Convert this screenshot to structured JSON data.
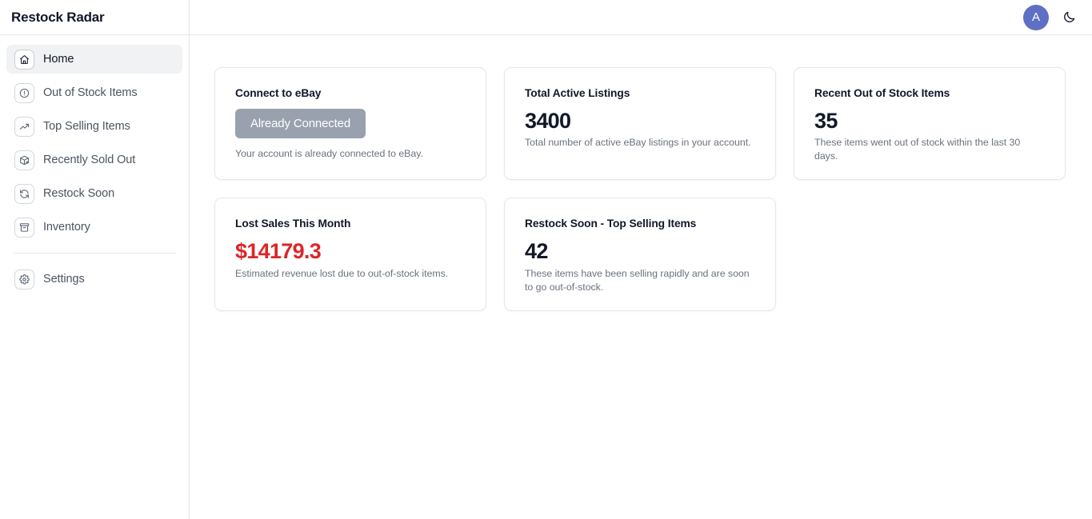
{
  "brand": {
    "title": "Restock Radar"
  },
  "sidebar": {
    "items": [
      {
        "label": "Home",
        "icon": "home-icon",
        "active": true
      },
      {
        "label": "Out of Stock Items",
        "icon": "alert-circle-icon",
        "active": false
      },
      {
        "label": "Top Selling Items",
        "icon": "trending-up-icon",
        "active": false
      },
      {
        "label": "Recently Sold Out",
        "icon": "package-x-icon",
        "active": false
      },
      {
        "label": "Restock Soon",
        "icon": "refresh-cw-icon",
        "active": false
      },
      {
        "label": "Inventory",
        "icon": "archive-icon",
        "active": false
      }
    ],
    "footer_items": [
      {
        "label": "Settings",
        "icon": "gear-icon",
        "active": false
      }
    ]
  },
  "topbar": {
    "avatar_initial": "A",
    "avatar_color": "#5f6fc4",
    "theme_toggle_icon": "moon-icon"
  },
  "cards": [
    {
      "id": "connect-to-ebay",
      "title": "Connect to eBay",
      "button_label": "Already Connected",
      "button_color": "#99a1ae",
      "note": "Your account is already connected to eBay."
    },
    {
      "id": "total-active-listings",
      "title": "Total Active Listings",
      "value": "3400",
      "description": "Total number of active eBay listings in your account."
    },
    {
      "id": "recent-out-of-stock-items",
      "title": "Recent Out of Stock Items",
      "value": "35",
      "description": "These items went out of stock within the last 30 days."
    },
    {
      "id": "lost-sales-this-month",
      "title": "Lost Sales This Month",
      "value": "$14179.3",
      "value_color": "#dd2626",
      "description": "Estimated revenue lost due to out-of-stock items."
    },
    {
      "id": "restock-soon-top-selling-items",
      "title": "Restock Soon - Top Selling Items",
      "value": "42",
      "description": "These items have been selling rapidly and are soon to go out-of-stock."
    }
  ]
}
